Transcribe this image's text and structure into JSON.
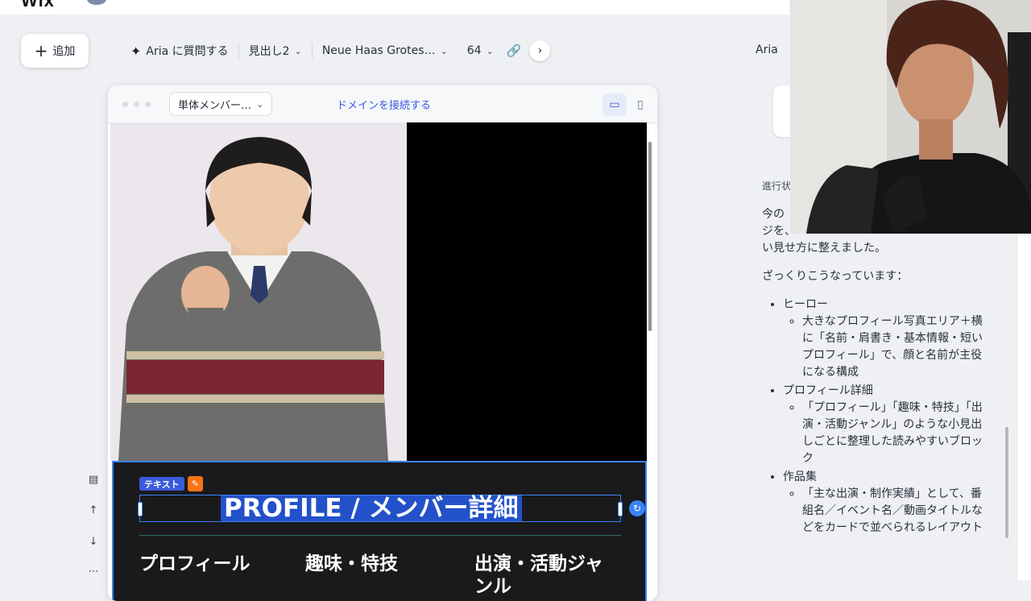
{
  "header": {
    "logo": "Wix"
  },
  "toolbar": {
    "add_label": "追加",
    "aria_ask": "Aria に質問する",
    "heading_style": "見出し2",
    "font_name": "Neue Haas Grotes…",
    "font_size": "64"
  },
  "preview": {
    "page_select": "単体メンバー…",
    "connect_domain": "ドメインを接続する",
    "tag_text": "テキスト",
    "title": "PROFILE / メンバー詳細",
    "columns": [
      "プロフィール",
      "趣味・特技",
      "出演・活動ジャ",
      "ンル"
    ]
  },
  "aria_panel": {
    "label": "Aria",
    "progress_label": "進行状",
    "message_lines": [
      "今の",
      "ジを、",
      "い見せ方に整えました。"
    ],
    "summary_intro": "ざっくりこうなっています：",
    "items": [
      {
        "title": "ヒーロー",
        "detail": "大きなプロフィール写真エリア＋横に「名前・肩書き・基本情報・短いプロフィール」で、顔と名前が主役になる構成"
      },
      {
        "title": "プロフィール詳細",
        "detail": "「プロフィール」「趣味・特技」「出演・活動ジャンル」のような小見出しごとに整理した読みやすいブロック"
      },
      {
        "title": "作品集",
        "detail": "「主な出演・制作実績」として、番組名／イベント名／動画タイトルなどをカードで並べられるレイアウト"
      }
    ]
  },
  "colors": {
    "accent": "#3b82f6",
    "selection": "#2251c9",
    "section_bg": "#1a1a1c",
    "link": "#3b59e0"
  }
}
